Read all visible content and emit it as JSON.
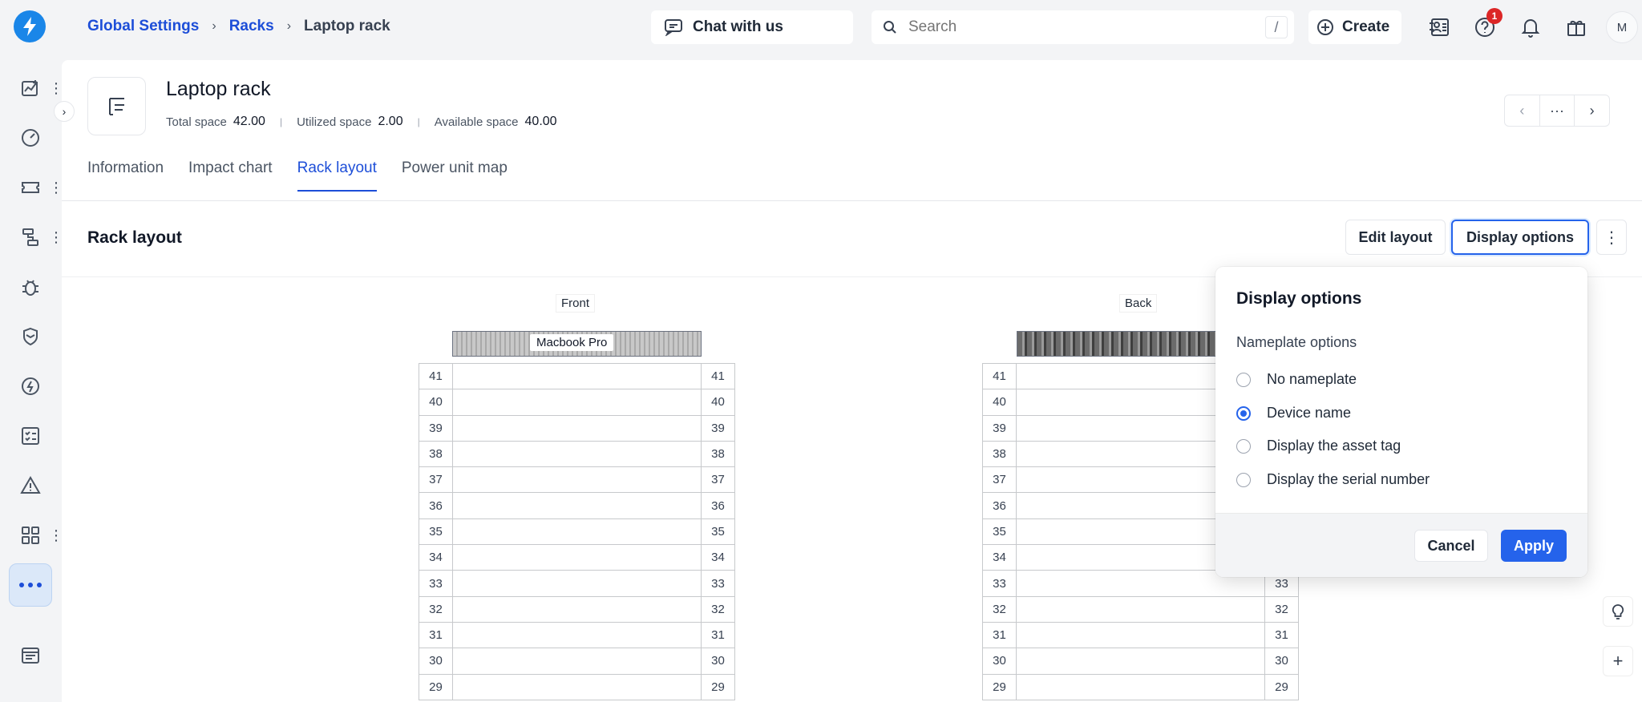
{
  "breadcrumb": {
    "root": "Global Settings",
    "parent": "Racks",
    "current": "Laptop rack"
  },
  "topbar": {
    "chat_label": "Chat with us",
    "search_placeholder": "Search",
    "search_shortcut": "/",
    "create_label": "Create",
    "help_badge": "1",
    "avatar_initial": "M"
  },
  "header": {
    "title": "Laptop rack",
    "stats": [
      {
        "label": "Total space",
        "value": "42.00"
      },
      {
        "label": "Utilized space",
        "value": "2.00"
      },
      {
        "label": "Available space",
        "value": "40.00"
      }
    ]
  },
  "tabs": [
    "Information",
    "Impact chart",
    "Rack layout",
    "Power unit map"
  ],
  "active_tab": "Rack layout",
  "section": {
    "title": "Rack layout",
    "edit_label": "Edit layout",
    "display_label": "Display options"
  },
  "rack": {
    "front_label": "Front",
    "back_label": "Back",
    "device_name": "Macbook Pro",
    "units": [
      "41",
      "40",
      "39",
      "38",
      "37",
      "36",
      "35",
      "34",
      "33",
      "32",
      "31",
      "30",
      "29"
    ]
  },
  "display_options": {
    "title": "Display options",
    "subtitle": "Nameplate options",
    "options": [
      "No nameplate",
      "Device name",
      "Display the asset tag",
      "Display the serial number"
    ],
    "selected": "Device name",
    "cancel_label": "Cancel",
    "apply_label": "Apply"
  },
  "colors": {
    "accent": "#2563eb",
    "brand": "#1a86e8",
    "badge": "#dc2626"
  }
}
